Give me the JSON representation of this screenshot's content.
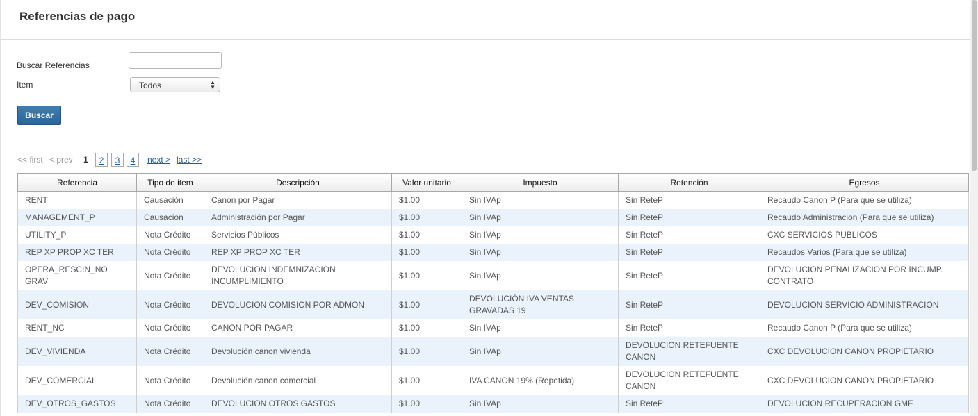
{
  "page": {
    "title": "Referencias de pago"
  },
  "form": {
    "search_label": "Buscar Referencias",
    "search_value": "",
    "item_label": "Item",
    "item_selected": "Todos",
    "submit_label": "Buscar"
  },
  "pager": {
    "first": "<< first",
    "prev": "< prev",
    "current": "1",
    "pages": [
      "2",
      "3",
      "4"
    ],
    "next": "next >",
    "last": "last >>"
  },
  "table": {
    "headers": [
      "Referencia",
      "Tipo de item",
      "Descripción",
      "Valor unitario",
      "Impuesto",
      "Retención",
      "Egresos"
    ],
    "rows": [
      [
        "RENT",
        "Causación",
        "Canon por Pagar",
        "$1.00",
        "Sin IVAp",
        "Sin ReteP",
        "Recaudo Canon P (Para que se utiliza)"
      ],
      [
        "MANAGEMENT_P",
        "Causación",
        "Administración por Pagar",
        "$1.00",
        "Sin IVAp",
        "Sin ReteP",
        "Recaudo Administracion (Para que se utiliza)"
      ],
      [
        "UTILITY_P",
        "Nota Crédito",
        "Servicios Públicos",
        "$1.00",
        "Sin IVAp",
        "Sin ReteP",
        "CXC SERVICIOS PUBLICOS"
      ],
      [
        "REP XP PROP XC TER",
        "Nota Crédito",
        "REP XP PROP XC TER",
        "$1.00",
        "Sin IVAp",
        "Sin ReteP",
        "Recaudos Varios (Para que se utiliza)"
      ],
      [
        "OPERA_RESCIN_NO GRAV",
        "Nota Crédito",
        "DEVOLUCION INDEMNIZACION INCUMPLIMIENTO",
        "$1.00",
        "Sin IVAp",
        "Sin ReteP",
        "DEVOLUCION PENALIZACION POR INCUMP. CONTRATO"
      ],
      [
        "DEV_COMISION",
        "Nota Crédito",
        "DEVOLUCION COMISION POR ADMON",
        "$1.00",
        "DEVOLUCIÓN IVA VENTAS GRAVADAS 19",
        "Sin ReteP",
        "DEVOLUCION SERVICIO ADMINISTRACION"
      ],
      [
        "RENT_NC",
        "Nota Crédito",
        "CANON POR PAGAR",
        "$1.00",
        "Sin IVAp",
        "Sin ReteP",
        "Recaudo Canon P (Para que se utiliza)"
      ],
      [
        "DEV_VIVIENDA",
        "Nota Crédito",
        "Devolución canon vivienda",
        "$1.00",
        "Sin IVAp",
        "DEVOLUCION RETEFUENTE CANON",
        "CXC DEVOLUCION CANON PROPIETARIO"
      ],
      [
        "DEV_COMERCIAL",
        "Nota Crédito",
        "Devolución canon comercial",
        "$1.00",
        "IVA CANON 19% (Repetida)",
        "DEVOLUCION RETEFUENTE CANON",
        "CXC DEVOLUCION CANON PROPIETARIO"
      ],
      [
        "DEV_OTROS_GASTOS",
        "Nota Crédito",
        "DEVOLUCION OTROS GASTOS",
        "$1.00",
        "Sin IVAp",
        "Sin ReteP",
        "DEVOLUCION RECUPERACION GMF"
      ]
    ]
  }
}
